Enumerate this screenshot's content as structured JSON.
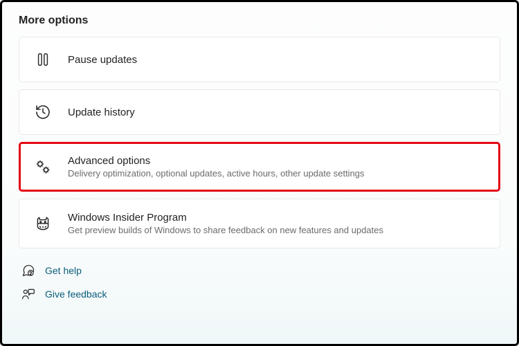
{
  "section_title": "More options",
  "options": {
    "pause": {
      "label": "Pause updates",
      "sub": ""
    },
    "history": {
      "label": "Update history",
      "sub": ""
    },
    "advanced": {
      "label": "Advanced options",
      "sub": "Delivery optimization, optional updates, active hours, other update settings"
    },
    "insider": {
      "label": "Windows Insider Program",
      "sub": "Get preview builds of Windows to share feedback on new features and updates"
    }
  },
  "links": {
    "help": "Get help",
    "feedback": "Give feedback"
  }
}
